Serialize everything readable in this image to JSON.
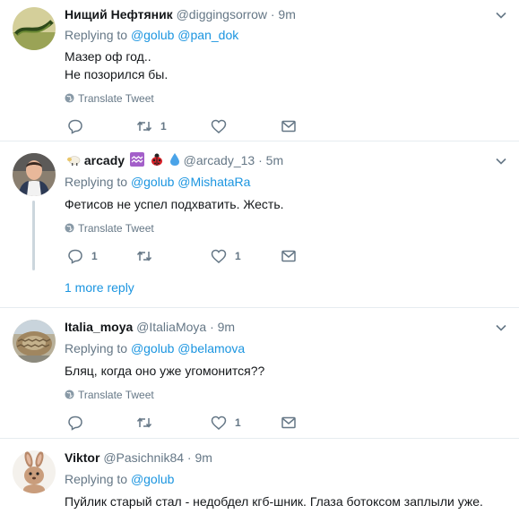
{
  "tweets": [
    {
      "fullname": "Нищий Нефтяник",
      "username": "@diggingsorrow",
      "time": "9m",
      "replying_to": "Replying to",
      "mentions": [
        "@golub",
        "@pan_dok"
      ],
      "text_lines": [
        "Мазер оф год..",
        "Не позорился бы."
      ],
      "translate": "Translate Tweet",
      "reply_count": "",
      "retweet_count": "1",
      "like_count": ""
    },
    {
      "fullname": "arcady",
      "username": "@arcady_13",
      "time": "5m",
      "replying_to": "Replying to",
      "mentions": [
        "@golub",
        "@MishataRa"
      ],
      "text_lines": [
        "Фетисов не успел подхватить. Жесть."
      ],
      "translate": "Translate Tweet",
      "reply_count": "1",
      "retweet_count": "",
      "like_count": "1",
      "more_replies": "1 more reply"
    },
    {
      "fullname": "Italia_moya",
      "username": "@ItaliaMoya",
      "time": "9m",
      "replying_to": "Replying to",
      "mentions": [
        "@golub",
        "@belamova"
      ],
      "text_lines": [
        "Бляц, когда оно уже угомонится??"
      ],
      "translate": "Translate Tweet",
      "reply_count": "",
      "retweet_count": "",
      "like_count": "1"
    },
    {
      "fullname": "Viktor",
      "username": "@Pasichnik84",
      "time": "9m",
      "replying_to": "Replying to",
      "mentions": [
        "@golub"
      ],
      "text_lines": [
        "Пуйлик старый стал - недобдел кгб-шник. Глаза ботоксом заплыли уже."
      ]
    }
  ],
  "separator": "·",
  "icons": {
    "reply": "reply-icon",
    "retweet": "retweet-icon",
    "like": "heart-icon",
    "dm": "envelope-icon",
    "globe": "globe-icon",
    "caret": "chevron-down-icon"
  },
  "colors": {
    "link": "#1b95e0",
    "secondary": "#657786",
    "border": "#e6ecf0"
  }
}
